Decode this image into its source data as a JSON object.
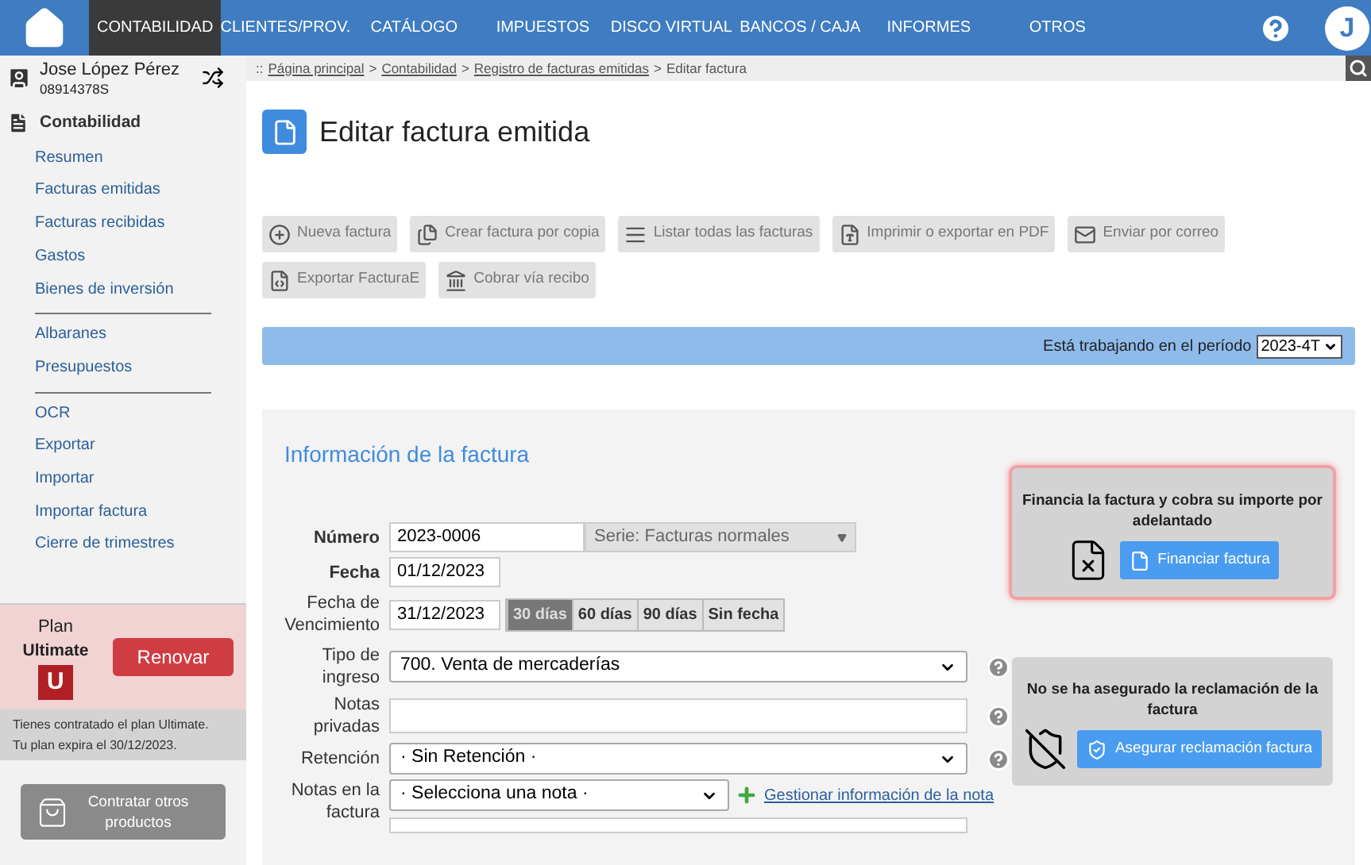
{
  "topnav": {
    "items": [
      {
        "label": "CONTABILIDAD",
        "selected": true
      },
      {
        "label": "CLIENTES/PROV.",
        "selected": false
      },
      {
        "label": "CATÁLOGO",
        "selected": false
      },
      {
        "label": "IMPUESTOS",
        "selected": false
      },
      {
        "label": "DISCO VIRTUAL",
        "selected": false
      },
      {
        "label": "BANCOS / CAJA",
        "selected": false
      },
      {
        "label": "INFORMES",
        "selected": false
      },
      {
        "label": "OTROS",
        "selected": false
      }
    ],
    "avatar": "J"
  },
  "user": {
    "name": "Jose López Pérez",
    "id": "08914378S"
  },
  "sidebar": {
    "section": "Contabilidad",
    "groups": [
      {
        "items": [
          "Resumen",
          "Facturas emitidas",
          "Facturas recibidas",
          "Gastos",
          "Bienes de inversión"
        ]
      },
      {
        "items": [
          "Albaranes",
          "Presupuestos"
        ]
      },
      {
        "items": [
          "OCR",
          "Exportar",
          "Importar",
          "Importar factura",
          "Cierre de trimestres"
        ]
      }
    ]
  },
  "plan": {
    "label": "Plan",
    "name": "Ultimate",
    "badge": "U",
    "button": "Renovar",
    "note": [
      "Tienes contratado el plan Ultimate.",
      "Tu plan expira el 30/12/2023."
    ]
  },
  "other_products": "Contratar otros productos",
  "breadcrumb": {
    "prefix": "::",
    "links": [
      "Página principal",
      "Contabilidad",
      "Registro de facturas emitidas"
    ],
    "separator": ">",
    "current": "Editar factura"
  },
  "title": "Editar factura emitida",
  "toolbar": [
    {
      "label": "Nueva factura",
      "kind": "new"
    },
    {
      "label": "Crear factura por copia",
      "kind": "copy"
    },
    {
      "label": "Listar todas las facturas",
      "kind": "list"
    },
    {
      "label": "Imprimir o exportar en PDF",
      "kind": "pdf"
    },
    {
      "label": "Enviar por correo",
      "kind": "mail"
    },
    {
      "label": "Exportar FacturaE",
      "kind": "export"
    },
    {
      "label": "Cobrar vía recibo",
      "kind": "bank"
    }
  ],
  "period": {
    "label": "Está trabajando en el período",
    "value": "2023-4T"
  },
  "form": {
    "title": "Información de la factura",
    "numero": {
      "label": "Número",
      "value": "2023-0006",
      "series": "Serie: Facturas normales"
    },
    "fecha": {
      "label": "Fecha",
      "value": "01/12/2023"
    },
    "vencimiento": {
      "label": "Fecha de Vencimiento",
      "value": "31/12/2023",
      "options": [
        {
          "label": "30 días",
          "selected": true
        },
        {
          "label": "60 días",
          "selected": false
        },
        {
          "label": "90 días",
          "selected": false
        },
        {
          "label": "Sin fecha",
          "selected": false
        }
      ]
    },
    "tipo": {
      "label": "Tipo de ingreso",
      "value": "700. Venta de mercaderías"
    },
    "notas_privadas": {
      "label": "Notas privadas"
    },
    "retencion": {
      "label": "Retención",
      "value": "· Sin Retención ·"
    },
    "notas_factura": {
      "label": "Notas en la factura",
      "value": "· Selecciona una nota ·",
      "link": "Gestionar información de la nota"
    }
  },
  "cards": [
    {
      "text": "Financia la factura y cobra su importe por adelantado",
      "button": "Financiar factura",
      "highlighted": true,
      "kind": "finance"
    },
    {
      "text": "No se ha asegurado la reclamación de la factura",
      "button": "Asegurar reclamación factura",
      "highlighted": false,
      "kind": "insure"
    }
  ]
}
